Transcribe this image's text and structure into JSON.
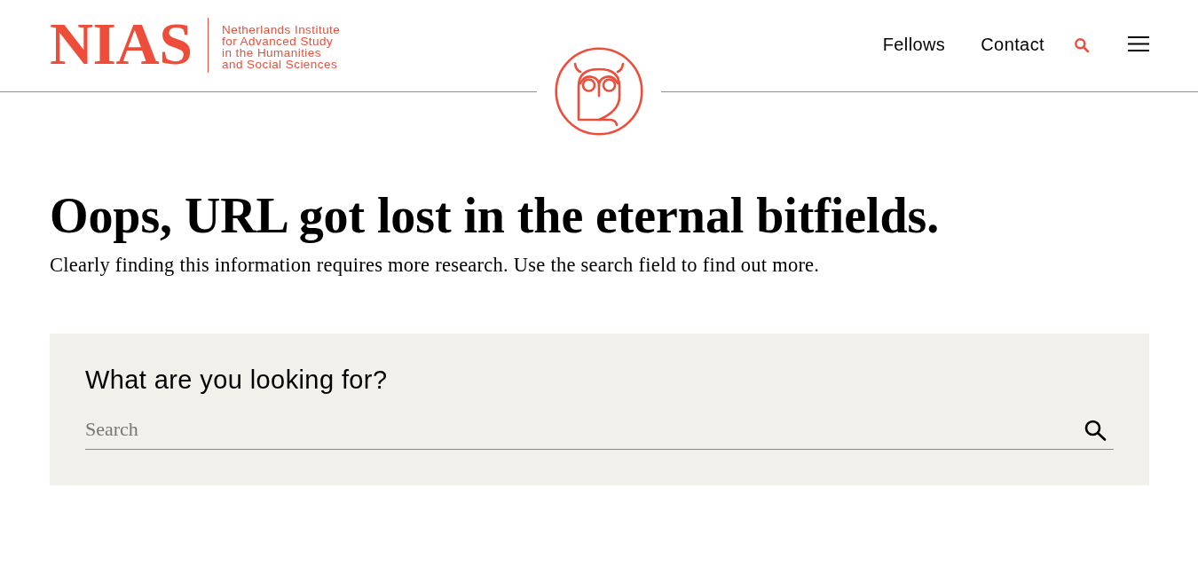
{
  "header": {
    "logo": {
      "wordmark": "NIAS",
      "tagline_lines": [
        "Netherlands Institute",
        "for Advanced Study",
        "in the Humanities",
        "and Social Sciences"
      ]
    },
    "nav": [
      {
        "label": "Fellows"
      },
      {
        "label": "Contact"
      }
    ]
  },
  "main": {
    "title": "Oops, URL got lost in the eternal bitfields.",
    "text": "Clearly finding this information requires more research. Use the search field to find out more."
  },
  "search_panel": {
    "label": "What are you looking for?",
    "placeholder": "Search"
  }
}
